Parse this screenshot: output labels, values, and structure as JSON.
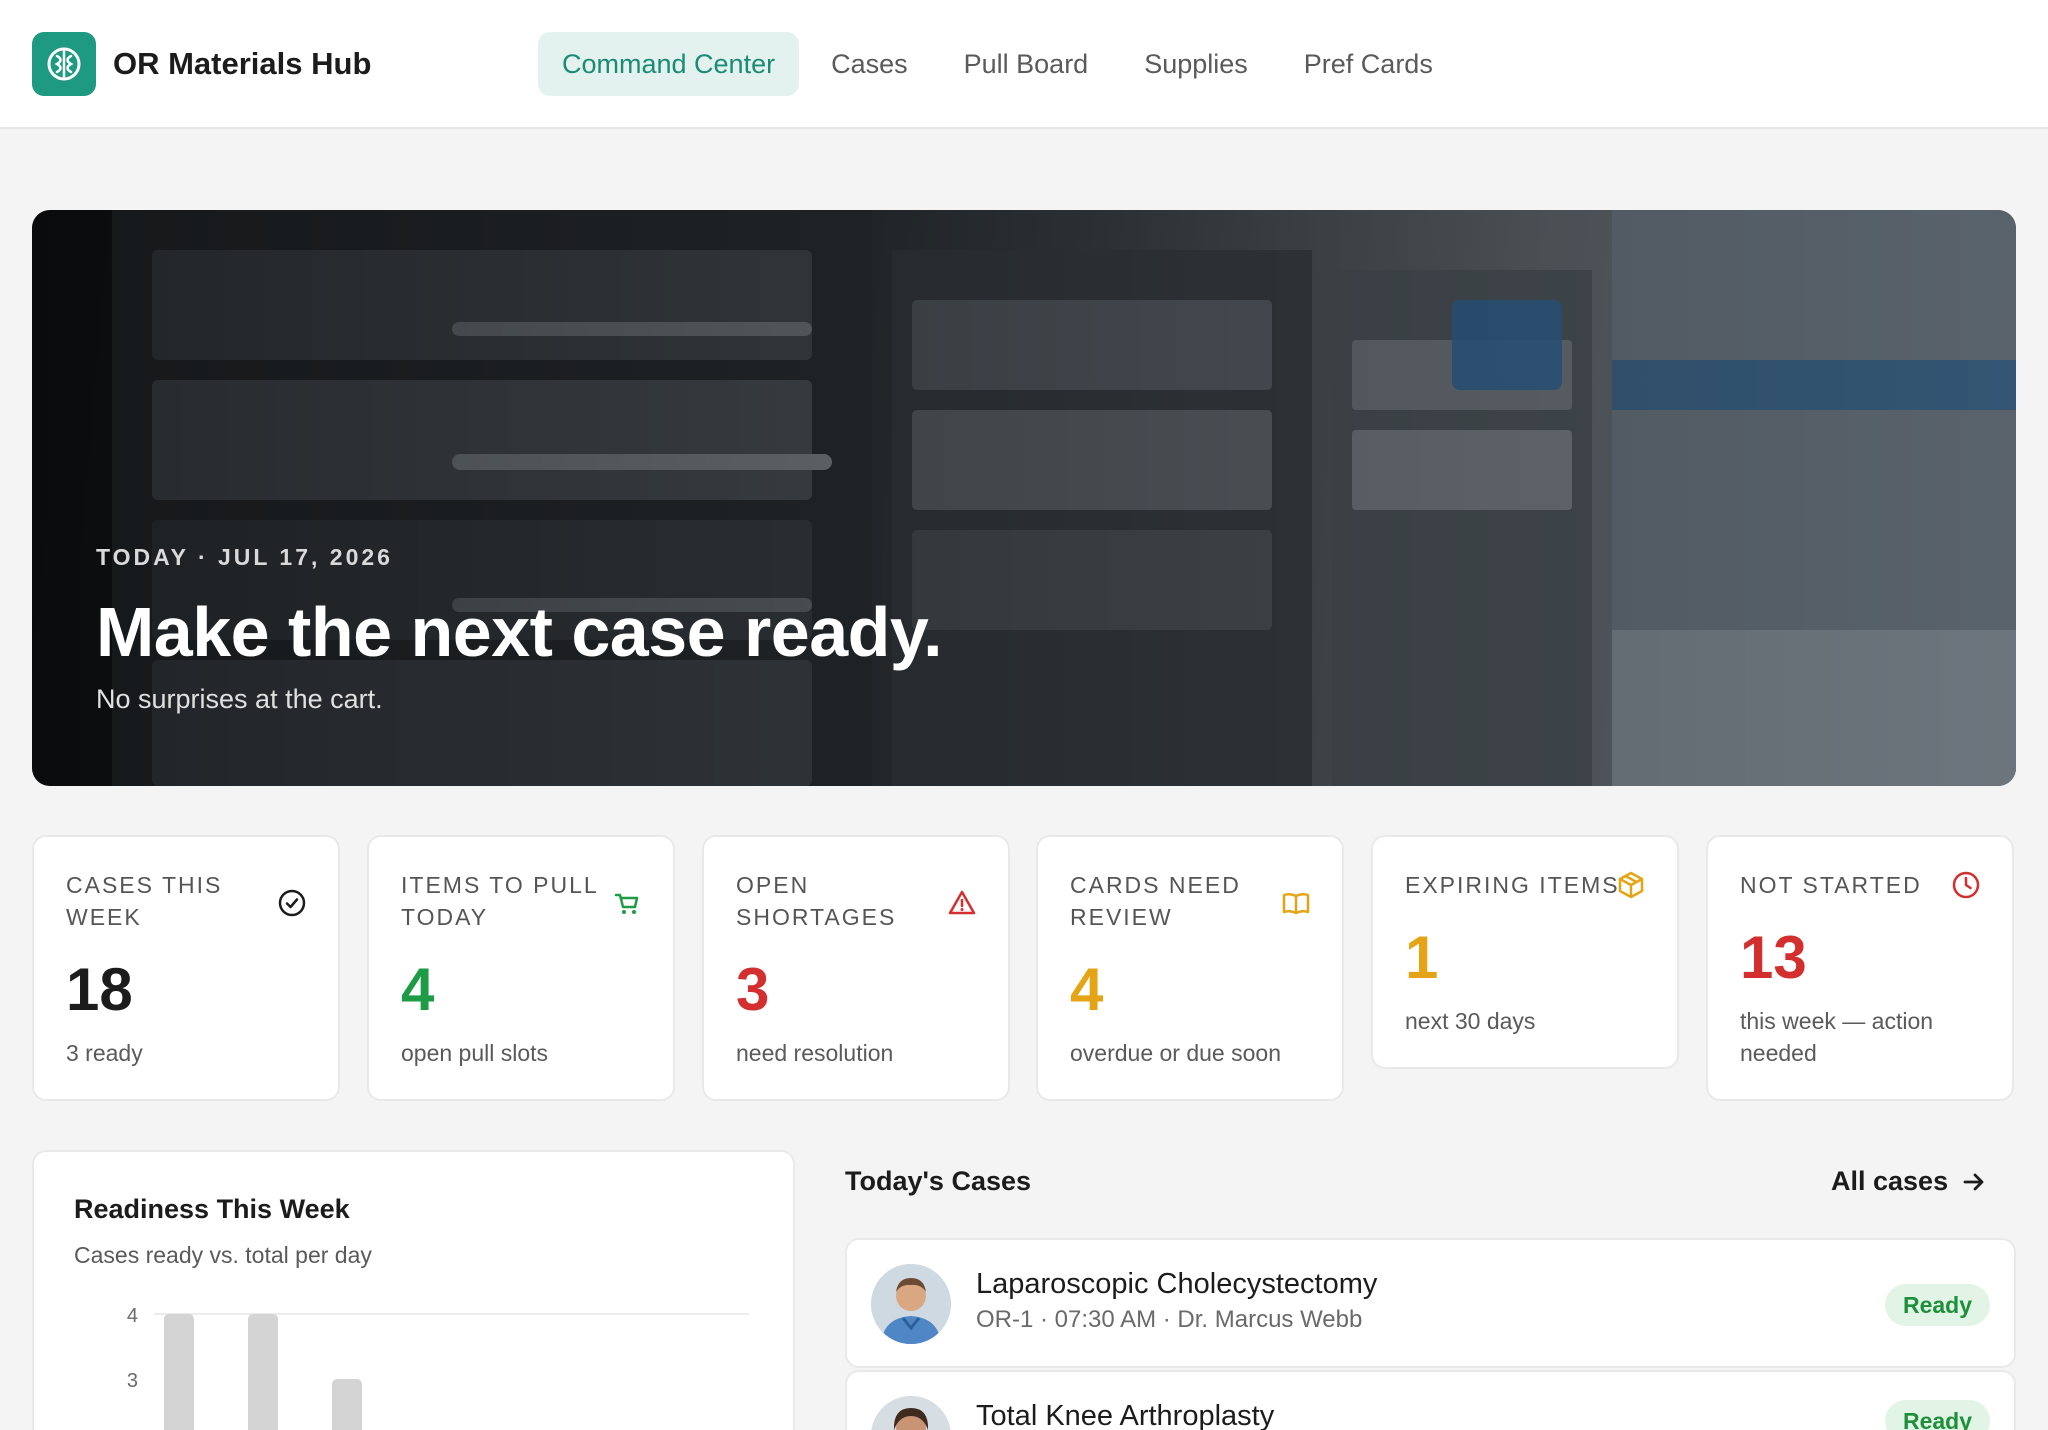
{
  "app": {
    "title": "OR Materials Hub",
    "accent_color": "#1f9a82",
    "logo_icon": "brain-icon"
  },
  "nav": {
    "items": [
      {
        "label": "Command Center",
        "active": true
      },
      {
        "label": "Cases",
        "active": false
      },
      {
        "label": "Pull Board",
        "active": false
      },
      {
        "label": "Supplies",
        "active": false
      },
      {
        "label": "Pref Cards",
        "active": false
      }
    ]
  },
  "hero": {
    "kicker": "TODAY · JUL 17, 2026",
    "title": "Make the next case ready.",
    "subtitle": "No surprises at the cart."
  },
  "stats": [
    {
      "label": "CASES THIS WEEK",
      "value": "18",
      "sub": "3 ready",
      "icon": "check-circle-icon",
      "color": "#1c1c1c"
    },
    {
      "label": "ITEMS TO PULL TODAY",
      "value": "4",
      "sub": "open pull slots",
      "icon": "cart-icon",
      "color": "#1e9b45"
    },
    {
      "label": "OPEN SHORTAGES",
      "value": "3",
      "sub": "need resolution",
      "icon": "warning-icon",
      "color": "#d42f2f"
    },
    {
      "label": "CARDS NEED REVIEW",
      "value": "4",
      "sub": "overdue or due soon",
      "icon": "book-icon",
      "color": "#e5a415"
    },
    {
      "label": "EXPIRING ITEMS",
      "value": "1",
      "sub": "next 30 days",
      "icon": "package-icon",
      "color": "#e5a415"
    },
    {
      "label": "NOT STARTED",
      "value": "13",
      "sub": "this week — action needed",
      "icon": "clock-icon",
      "color": "#d42f2f"
    }
  ],
  "readiness": {
    "title": "Readiness This Week",
    "subtitle": "Cases ready vs. total per day"
  },
  "chart_data": {
    "type": "bar",
    "title": "Readiness This Week",
    "subtitle": "Cases ready vs. total per day",
    "y_ticks": [
      "4",
      "3"
    ],
    "ylim": [
      0,
      4
    ],
    "grid": true,
    "series": [
      {
        "values": [
          4,
          4,
          3
        ]
      }
    ]
  },
  "cases": {
    "heading": "Today's Cases",
    "all_link": "All cases",
    "items": [
      {
        "title": "Laparoscopic Cholecystectomy",
        "meta": "OR-1 · 07:30 AM · Dr. Marcus Webb",
        "status": "Ready"
      },
      {
        "title": "Total Knee Arthroplasty",
        "meta": "",
        "status": "Ready"
      }
    ]
  }
}
